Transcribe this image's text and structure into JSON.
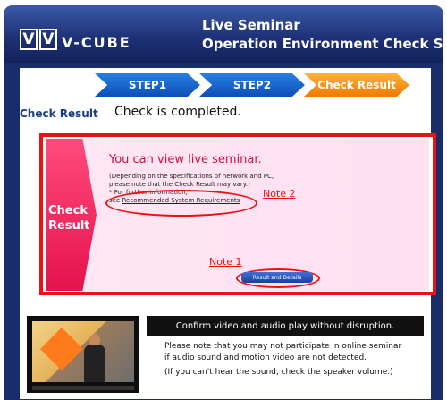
{
  "header": {
    "logo_text": "V-CUBE",
    "title_line1": "Live Seminar",
    "title_line2": "Operation Environment Check Site"
  },
  "steps": [
    "STEP1",
    "STEP2",
    "Check Result"
  ],
  "check_result": {
    "label": "Check Result",
    "status": "Check is completed."
  },
  "panel": {
    "side_label_line1": "Check",
    "side_label_line2": "Result",
    "heading": "You can view live seminar.",
    "note_line1": "(Depending on the specifications of network and PC,",
    "note_line2": "please note that the Check Result may vary.)",
    "note_line3": "* For further information,",
    "link_prefix": "see",
    "link_text": "Recommended System Requirements",
    "button_label": "Result and Details"
  },
  "annotations": {
    "note1": "Note 1",
    "note2": "Note 2"
  },
  "bottom": {
    "confirm": "Confirm video and audio play without disruption.",
    "text_line1": "Please note that you may not participate in online seminar",
    "text_line2": "if audio sound and motion video are not detected.",
    "text_line3": "(If you can't hear the sound, check the speaker volume.)"
  },
  "colors": {
    "header_bg": "#1f3278",
    "step_blue": "#0b4fb8",
    "step_orange": "#f07a00",
    "highlight_red": "#ee1111",
    "panel_pink": "#ffe7f3",
    "side_pink": "#e5124c"
  }
}
